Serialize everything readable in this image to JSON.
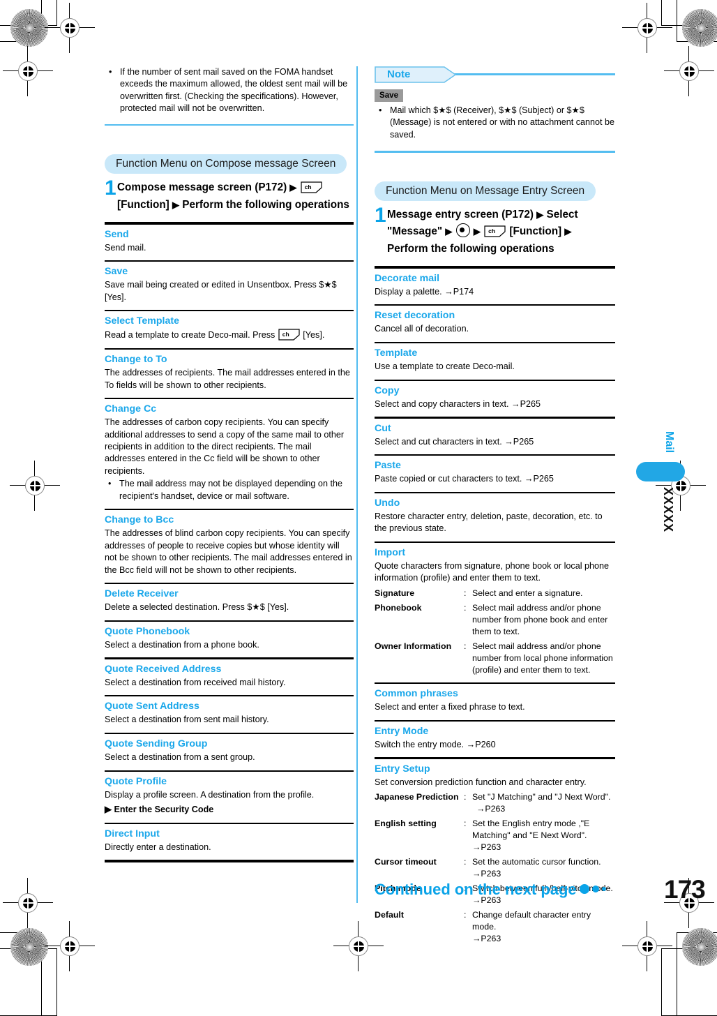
{
  "page": {
    "number": "173",
    "continued_label": "Continued on the next page",
    "side_tab": {
      "chapter": "Mail",
      "section": "XXXXX"
    }
  },
  "left_column": {
    "top_bullets": [
      "If the number of sent mail saved on the FOMA handset exceeds the maximum allowed, the oldest sent mail will be overwritten first. (Checking the specifications). However, protected mail will not be overwritten."
    ],
    "section_title": "Function Menu on Compose message Screen",
    "step": {
      "number": "1",
      "part1": "Compose message screen (P172)",
      "key1": "ch",
      "part2": "[Function]",
      "part3": "Perform the following operations"
    },
    "entries": [
      {
        "title": "Send",
        "desc": "Send mail."
      },
      {
        "title": "Save",
        "desc": "Save mail being created or edited in Unsentbox. Press $★$ [Yes]."
      },
      {
        "title": "Select Template",
        "desc_pre": "Read a template to create Deco-mail. Press",
        "key": "ch",
        "desc_post": "[Yes]."
      },
      {
        "title": "Change to To",
        "desc": "The addresses of recipients. The mail addresses entered in the To fields will be shown to other recipients."
      },
      {
        "title": "Change Cc",
        "desc": "The addresses of carbon copy recipients. You can specify additional addresses to send a copy of the same mail to other recipients in addition to the direct recipients. The mail addresses entered in the Cc field will be shown to other recipients.",
        "sub_bullets": [
          "The mail address may not be displayed depending on the recipient's handset, device or mail software."
        ]
      },
      {
        "title": "Change to Bcc",
        "desc": "The addresses of blind carbon copy recipients. You can specify addresses of people to receive copies but whose identity will not be shown to other recipients. The mail addresses entered in the Bcc field will not be shown to other recipients."
      },
      {
        "title": "Delete Receiver",
        "desc": "Delete a selected destination. Press $★$ [Yes]."
      },
      {
        "title": "Quote Phonebook",
        "desc": "Select a destination from a phone book."
      },
      {
        "title": "Quote Received Address",
        "desc": "Select a destination from received mail history."
      },
      {
        "title": "Quote Sent Address",
        "desc": "Select a destination from sent mail history."
      },
      {
        "title": "Quote Sending Group",
        "desc": "Select a destination from a sent group."
      },
      {
        "title": "Quote Profile",
        "desc": "Display a profile screen. A destination from the profile.",
        "arrow_line": "Enter the Security Code"
      },
      {
        "title": "Direct Input",
        "desc": "Directly enter a destination."
      }
    ]
  },
  "right_column": {
    "note": {
      "label": "Note",
      "badge": "Save",
      "bullets": [
        "Mail which $★$ (Receiver), $★$ (Subject) or $★$ (Message) is not entered or with no attachment cannot be saved."
      ]
    },
    "section_title": "Function Menu on Message Entry Screen",
    "step": {
      "number": "1",
      "part1": "Message entry screen (P172)",
      "part2": "Select \"Message\"",
      "key_circle": "select-key",
      "key1": "ch",
      "part3": "[Function]",
      "part4": "Perform the following operations"
    },
    "entries": [
      {
        "title": "Decorate mail",
        "desc": "Display a palette.",
        "ref": "P174"
      },
      {
        "title": "Reset decoration",
        "desc": "Cancel all of decoration."
      },
      {
        "title": "Template",
        "desc": "Use a template to create Deco-mail."
      },
      {
        "title": "Copy",
        "desc": "Select and copy characters in text.",
        "ref": "P265"
      },
      {
        "title": "Cut",
        "desc": "Select and cut characters in text.",
        "ref": "P265"
      },
      {
        "title": "Paste",
        "desc": "Paste copied or cut characters to text.",
        "ref": "P265"
      },
      {
        "title": "Undo",
        "desc": "Restore character entry, deletion, paste, decoration, etc. to the previous state."
      },
      {
        "title": "Import",
        "desc": "Quote characters from signature, phone book or local phone information (profile) and enter them to text.",
        "defs": [
          {
            "term": "Signature",
            "value": "Select and enter a signature."
          },
          {
            "term": "Phonebook",
            "value": "Select mail address and/or phone number from phone book and enter them to text."
          },
          {
            "term": "Owner Information",
            "value": "Select mail address and/or phone number from local phone information (profile) and enter them to text."
          }
        ]
      },
      {
        "title": "Common phrases",
        "desc": "Select and enter a fixed phrase to text."
      },
      {
        "title": "Entry Mode",
        "desc": "Switch the entry mode.",
        "ref": "P260"
      },
      {
        "title": "Entry Setup",
        "desc": "Set conversion prediction function and character entry.",
        "defs": [
          {
            "term": "Japanese Prediction",
            "value": "Set \"J Matching\" and \"J Next Word\".",
            "ref": "P263"
          },
          {
            "term": "English setting",
            "value": "Set the English entry mode ,\"E Matching\" and \"E Next Word\".",
            "ref": "P263",
            "ref_inline": true
          },
          {
            "term": "Cursor timeout",
            "value": "Set the automatic cursor function.",
            "ref": "P263"
          },
          {
            "term": "Pitch mode",
            "value": "Switch between full-/half-pitch mode.",
            "ref": "P263"
          },
          {
            "term": "Default",
            "value": "Change default character entry mode.",
            "ref": "P263"
          }
        ]
      }
    ]
  },
  "colors": {
    "accent_blue": "#1aa7ea",
    "rule_blue": "#53bdf0",
    "pill_blue": "#c9e8f9",
    "tab_blue": "#22a7e5",
    "badge_gray": "#9a9a9a"
  }
}
